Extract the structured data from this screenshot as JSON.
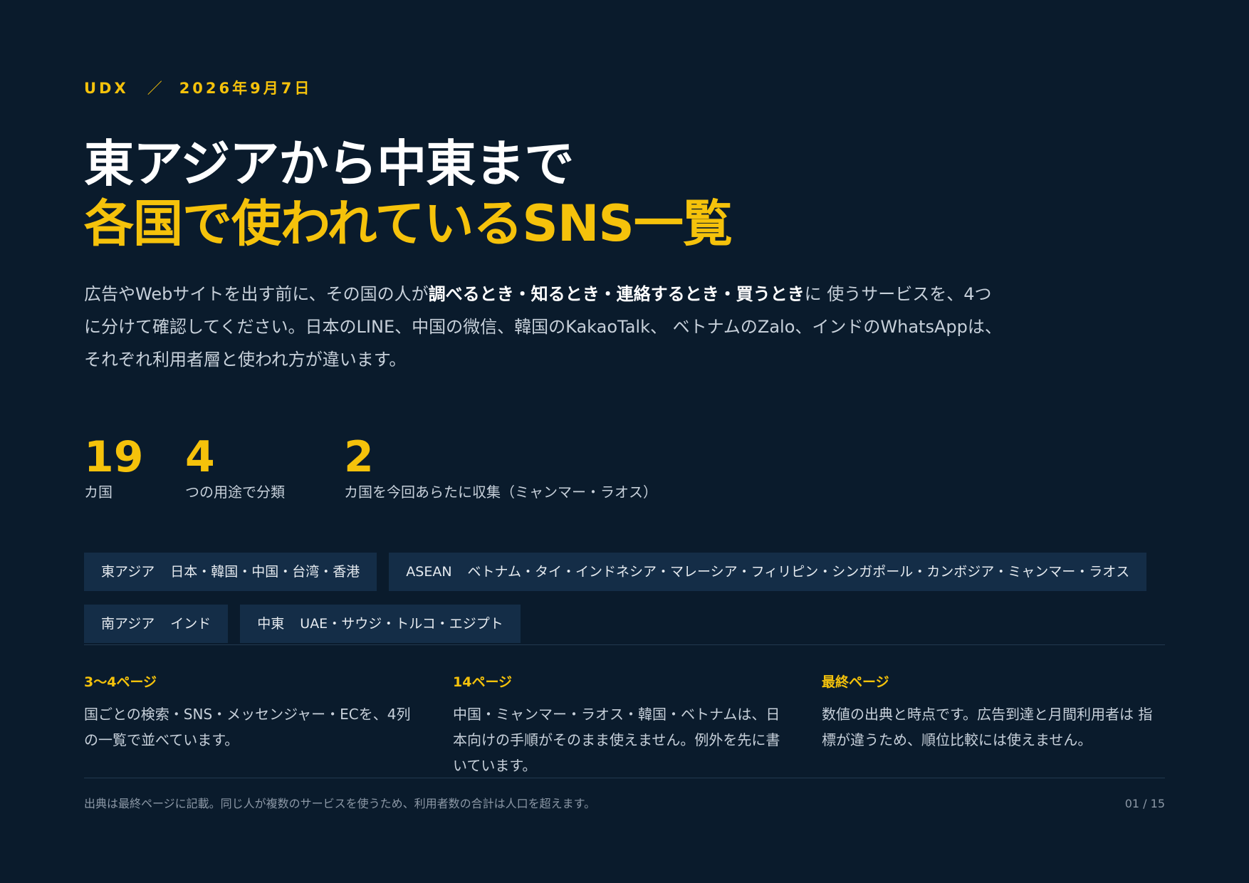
{
  "header": {
    "brand": "UDX",
    "separator": "／",
    "date": "2026年9月7日"
  },
  "title": {
    "line1": "東アジアから中東まで",
    "line2": "各国で使われているSNS一覧"
  },
  "lead": {
    "before": "広告やWebサイトを出す前に、その国の人が",
    "emphasis": "調べるとき・知るとき・連絡するとき・買うとき",
    "after": "に 使うサービスを、4つに分けて確認してください。日本のLINE、中国の微信、韓国のKakaoTalk、 ベトナムのZalo、インドのWhatsAppは、それぞれ利用者層と使われ方が違います。"
  },
  "stats": [
    {
      "value": "19",
      "label": "カ国"
    },
    {
      "value": "4",
      "label": "つの用途で分類"
    },
    {
      "value": "2",
      "label": "カ国を今回あらたに収集（ミャンマー・ラオス）"
    }
  ],
  "regions": [
    {
      "region": "東アジア",
      "countries": "日本・韓国・中国・台湾・香港"
    },
    {
      "region": "ASEAN",
      "countries": "ベトナム・タイ・インドネシア・マレーシア・フィリピン・シンガポール・カンボジア・ミャンマー・ラオス"
    },
    {
      "region": "南アジア",
      "countries": "インド"
    },
    {
      "region": "中東",
      "countries": "UAE・サウジ・トルコ・エジプト"
    }
  ],
  "guide": [
    {
      "title": "3～4ページ",
      "body": "国ごとの検索・SNS・メッセンジャー・ECを、4列の一覧で並べています。"
    },
    {
      "title": "14ページ",
      "body": "中国・ミャンマー・ラオス・韓国・ベトナムは、日本向けの手順がそのまま使えません。例外を先に書いています。"
    },
    {
      "title": "最終ページ",
      "body": "数値の出典と時点です。広告到達と月間利用者は 指標が違うため、順位比較には使えません。"
    }
  ],
  "footer": {
    "note": "出典は最終ページに記載。同じ人が複数のサービスを使うため、利用者数の合計は人口を超えます。",
    "page": "01 / 15"
  },
  "colors": {
    "background": "#0a1b2c",
    "accent": "#f5c20b",
    "chip": "#142d47"
  }
}
